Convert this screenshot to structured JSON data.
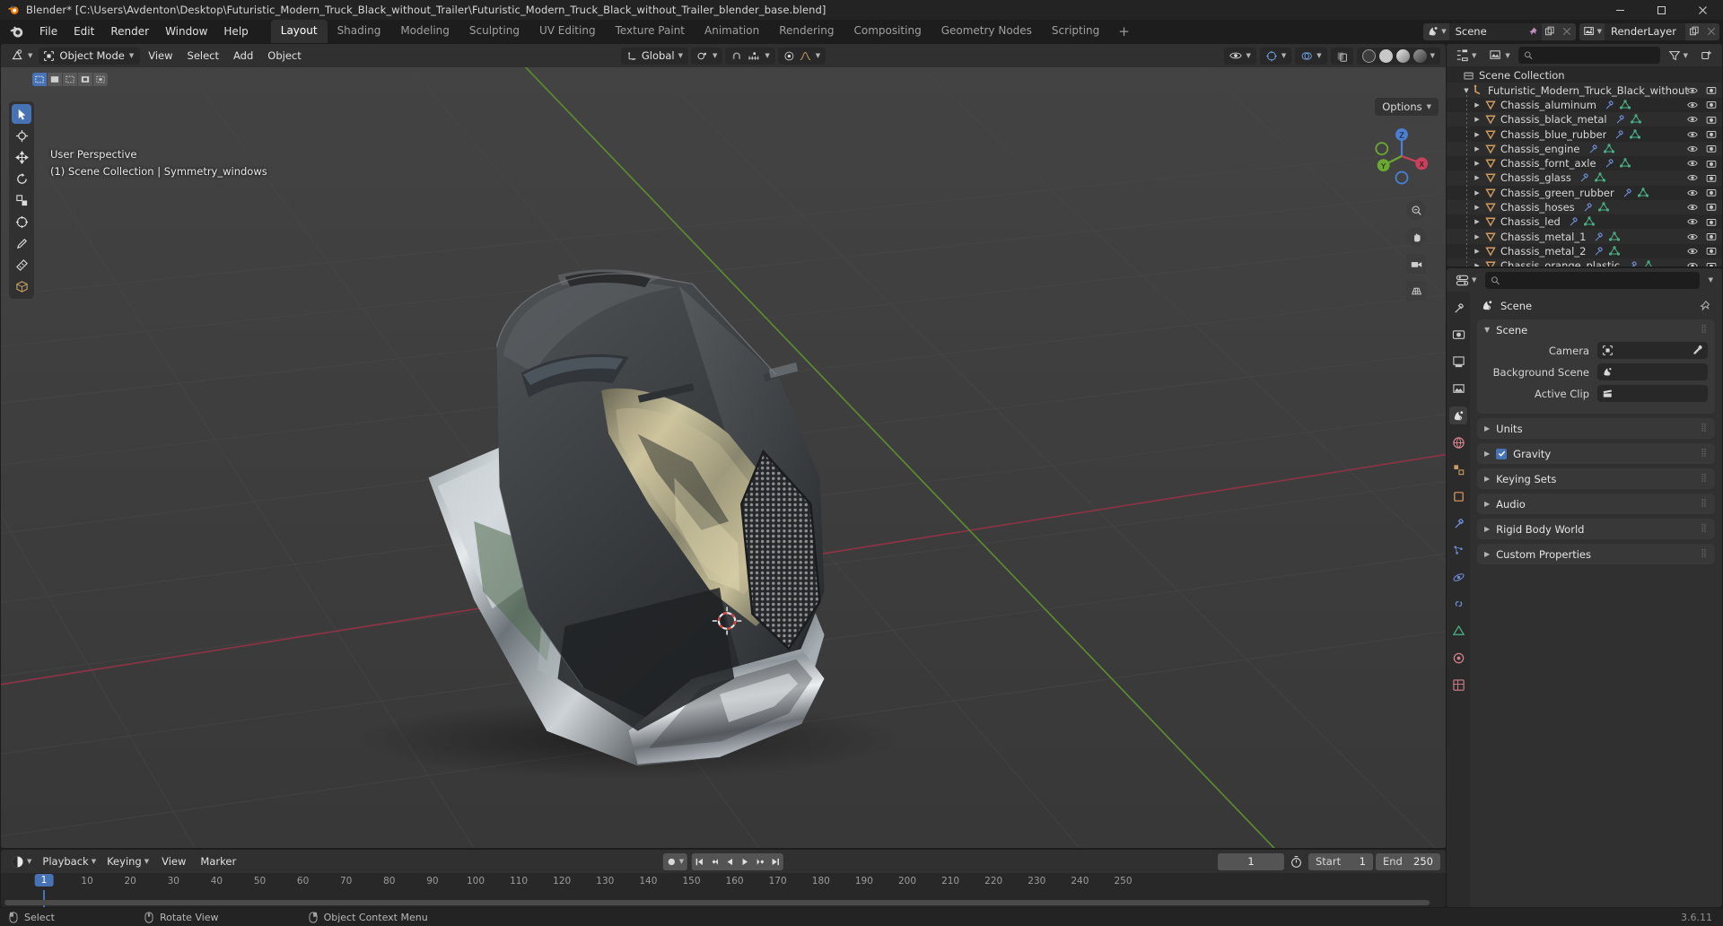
{
  "window": {
    "title": "Blender* [C:\\Users\\Avdenton\\Desktop\\Futuristic_Modern_Truck_Black_without_Trailer\\Futuristic_Modern_Truck_Black_without_Trailer_blender_base.blend]",
    "minimize": "—",
    "maximize": "❐",
    "close": "✕"
  },
  "menu": {
    "items": [
      "File",
      "Edit",
      "Render",
      "Window",
      "Help"
    ]
  },
  "workspace_tabs": [
    {
      "label": "Layout",
      "active": true
    },
    {
      "label": "Shading",
      "active": false
    },
    {
      "label": "Modeling",
      "active": false
    },
    {
      "label": "Sculpting",
      "active": false
    },
    {
      "label": "UV Editing",
      "active": false
    },
    {
      "label": "Texture Paint",
      "active": false
    },
    {
      "label": "Animation",
      "active": false
    },
    {
      "label": "Rendering",
      "active": false
    },
    {
      "label": "Compositing",
      "active": false
    },
    {
      "label": "Geometry Nodes",
      "active": false
    },
    {
      "label": "Scripting",
      "active": false
    }
  ],
  "workspace_add": "+",
  "topbar_right": {
    "scene_name": "Scene",
    "viewlayer_name": "RenderLayer"
  },
  "viewport": {
    "mode": "Object Mode",
    "menus": [
      "View",
      "Select",
      "Add",
      "Object"
    ],
    "transform_orientation": "Global",
    "options_label": "Options",
    "overlay_line1": "User Perspective",
    "overlay_line2": "(1) Scene Collection | Symmetry_windows",
    "gizmo_axes": {
      "x": "X",
      "y": "Y",
      "z": "Z"
    },
    "tools": [
      "tweak-select-tool",
      "cursor-tool",
      "move-tool",
      "rotate-tool",
      "scale-tool",
      "transform-tool",
      "annotate-tool",
      "measure-tool",
      "add-cube-tool"
    ]
  },
  "outliner": {
    "search_placeholder": "",
    "root": "Scene Collection",
    "collection": "Futuristic_Modern_Truck_Black_without",
    "items": [
      {
        "name": "Chassis_aluminum"
      },
      {
        "name": "Chassis_black_metal"
      },
      {
        "name": "Chassis_blue_rubber"
      },
      {
        "name": "Chassis_engine"
      },
      {
        "name": "Chassis_fornt_axle"
      },
      {
        "name": "Chassis_glass"
      },
      {
        "name": "Chassis_green_rubber"
      },
      {
        "name": "Chassis_hoses"
      },
      {
        "name": "Chassis_led"
      },
      {
        "name": "Chassis_metal_1"
      },
      {
        "name": "Chassis_metal_2"
      },
      {
        "name": "Chassis_orange_plastic"
      }
    ]
  },
  "properties": {
    "search_placeholder": "",
    "breadcrumb": "Scene",
    "panels": [
      {
        "title": "Scene",
        "open": true,
        "checkbox": false
      },
      {
        "title": "Units",
        "open": false,
        "checkbox": false
      },
      {
        "title": "Gravity",
        "open": false,
        "checkbox": true
      },
      {
        "title": "Keying Sets",
        "open": false,
        "checkbox": false
      },
      {
        "title": "Audio",
        "open": false,
        "checkbox": false
      },
      {
        "title": "Rigid Body World",
        "open": false,
        "checkbox": false
      },
      {
        "title": "Custom Properties",
        "open": false,
        "checkbox": false
      }
    ],
    "scene_rows": [
      {
        "label": "Camera",
        "value": "",
        "icon": "camera-data-icon",
        "eyedropper": true
      },
      {
        "label": "Background Scene",
        "value": "",
        "icon": "scene-icon",
        "eyedropper": false
      },
      {
        "label": "Active Clip",
        "value": "",
        "icon": "clip-icon",
        "eyedropper": false
      }
    ]
  },
  "timeline": {
    "menus": [
      "Playback",
      "Keying",
      "View",
      "Marker"
    ],
    "current_frame": "1",
    "start_label": "Start",
    "start_value": "1",
    "end_label": "End",
    "end_value": "250",
    "ticks": [
      "10",
      "20",
      "30",
      "40",
      "50",
      "60",
      "70",
      "80",
      "90",
      "100",
      "110",
      "120",
      "130",
      "140",
      "150",
      "160",
      "170",
      "180",
      "190",
      "200",
      "210",
      "220",
      "230",
      "240",
      "250"
    ],
    "playhead_label": "1"
  },
  "statusbar": {
    "items": [
      {
        "label": "Select",
        "mouse": "left"
      },
      {
        "label": "Rotate View",
        "mouse": "middle"
      },
      {
        "label": "Object Context Menu",
        "mouse": "right"
      }
    ],
    "version": "3.6.11"
  },
  "colors": {
    "accent": "#4772b3",
    "header": "#303030",
    "panel": "#383838",
    "field": "#282828",
    "viewport_bg": "#3d3d3d",
    "collection_orange": "#d09b5e",
    "mesh_green": "#4ab38a",
    "modifier_blue": "#6e8fd8",
    "axis_x": "#c9415a",
    "axis_y": "#6aa832"
  }
}
